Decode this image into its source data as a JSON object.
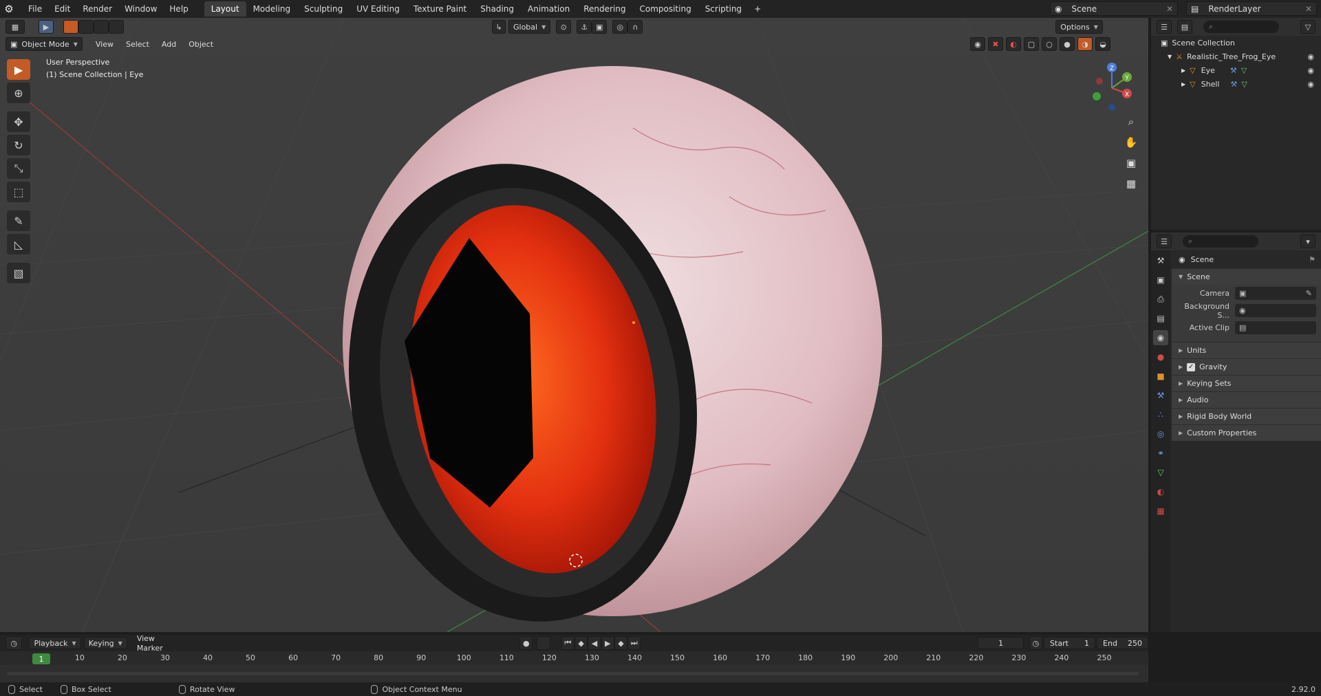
{
  "topbar": {
    "menus": [
      "File",
      "Edit",
      "Render",
      "Window",
      "Help"
    ],
    "workspaces": [
      "Layout",
      "Modeling",
      "Sculpting",
      "UV Editing",
      "Texture Paint",
      "Shading",
      "Animation",
      "Rendering",
      "Compositing",
      "Scripting"
    ],
    "active_workspace": "Layout",
    "add_tab": "+",
    "scene": "Scene",
    "view_layer": "RenderLayer"
  },
  "viewport_header": {
    "mode": "Object Mode",
    "menus": [
      "View",
      "Select",
      "Add",
      "Object"
    ],
    "orientation": "Global",
    "options": "Options"
  },
  "viewport": {
    "perspective": "User Perspective",
    "collection": "(1) Scene Collection | Eye"
  },
  "gizmo": {
    "x": "X",
    "y": "Y",
    "z": "Z"
  },
  "outliner": {
    "root": "Scene Collection",
    "items": [
      {
        "name": "Realistic_Tree_Frog_Eye",
        "level": 1
      },
      {
        "name": "Eye",
        "level": 2
      },
      {
        "name": "Shell",
        "level": 2
      }
    ]
  },
  "properties": {
    "breadcrumb": "Scene",
    "section": "Scene",
    "fields": [
      {
        "label": "Camera",
        "value": ""
      },
      {
        "label": "Background S...",
        "value": ""
      },
      {
        "label": "Active Clip",
        "value": ""
      }
    ],
    "subsections": [
      {
        "label": "Units",
        "checkbox": false
      },
      {
        "label": "Gravity",
        "checkbox": true
      },
      {
        "label": "Keying Sets",
        "checkbox": false
      },
      {
        "label": "Audio",
        "checkbox": false
      },
      {
        "label": "Rigid Body World",
        "checkbox": false
      },
      {
        "label": "Custom Properties",
        "checkbox": false
      }
    ]
  },
  "timeline": {
    "menus": [
      "Playback",
      "Keying",
      "View",
      "Marker"
    ],
    "current_frame": "1",
    "start_label": "Start",
    "start": "1",
    "end_label": "End",
    "end": "250",
    "ruler": [
      "1",
      "10",
      "20",
      "30",
      "40",
      "50",
      "60",
      "70",
      "80",
      "90",
      "100",
      "110",
      "120",
      "130",
      "140",
      "150",
      "160",
      "170",
      "180",
      "190",
      "200",
      "210",
      "220",
      "230",
      "240",
      "250"
    ]
  },
  "statusbar": {
    "items": [
      "Select",
      "Box Select",
      "Rotate View",
      "Object Context Menu"
    ],
    "version": "2.92.0"
  },
  "colors": {
    "accent": "#c45a25",
    "selected": "#4a6080",
    "frame": "#3e8a3e"
  }
}
